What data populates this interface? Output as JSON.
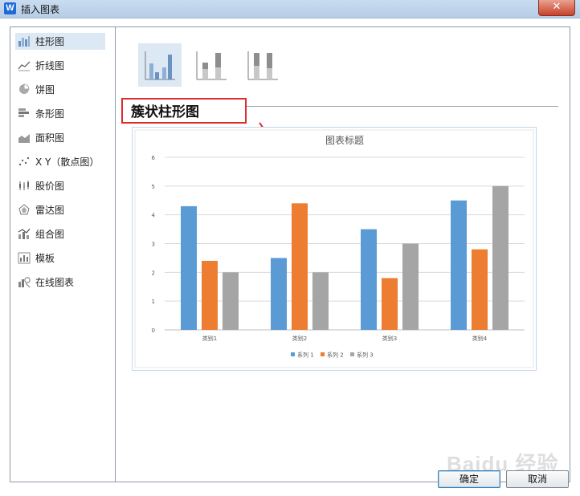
{
  "window": {
    "title": "插入图表",
    "close_symbol": "✕"
  },
  "sidebar": {
    "items": [
      {
        "label": "柱形图",
        "icon": "column-chart-icon"
      },
      {
        "label": "折线图",
        "icon": "line-chart-icon"
      },
      {
        "label": "饼图",
        "icon": "pie-chart-icon"
      },
      {
        "label": "条形图",
        "icon": "bar-chart-icon"
      },
      {
        "label": "面积图",
        "icon": "area-chart-icon"
      },
      {
        "label": "X Y（散点图）",
        "icon": "scatter-chart-icon"
      },
      {
        "label": "股价图",
        "icon": "stock-chart-icon"
      },
      {
        "label": "雷达图",
        "icon": "radar-chart-icon"
      },
      {
        "label": "组合图",
        "icon": "combo-chart-icon"
      },
      {
        "label": "模板",
        "icon": "template-icon"
      },
      {
        "label": "在线图表",
        "icon": "online-chart-icon"
      }
    ],
    "selected_index": 0
  },
  "subtypes": [
    {
      "name": "clustered-column",
      "icon": "clustered-column-icon",
      "selected": true
    },
    {
      "name": "stacked-column",
      "icon": "stacked-column-icon",
      "selected": false
    },
    {
      "name": "percent-stacked-column",
      "icon": "percent-stacked-column-icon",
      "selected": false
    }
  ],
  "chart_name": "簇状柱形图",
  "annotation": {
    "color": "#e02b2b"
  },
  "chart_data": {
    "type": "bar",
    "title": "图表标题",
    "categories": [
      "类别1",
      "类别2",
      "类别3",
      "类别4"
    ],
    "series": [
      {
        "name": "系列 1",
        "values": [
          4.3,
          2.5,
          3.5,
          4.5
        ],
        "color": "#5b9bd5"
      },
      {
        "name": "系列 2",
        "values": [
          2.4,
          4.4,
          1.8,
          2.8
        ],
        "color": "#ed7d31"
      },
      {
        "name": "系列 3",
        "values": [
          2,
          2,
          3,
          5
        ],
        "color": "#a5a5a5"
      }
    ],
    "ylim": [
      0,
      6
    ],
    "yticks": [
      "0",
      "1",
      "2",
      "3",
      "4",
      "5",
      "6"
    ],
    "grid": true,
    "legend": "bottom"
  },
  "buttons": {
    "ok": "确定",
    "cancel": "取消"
  },
  "watermark": "Baidu 经验"
}
